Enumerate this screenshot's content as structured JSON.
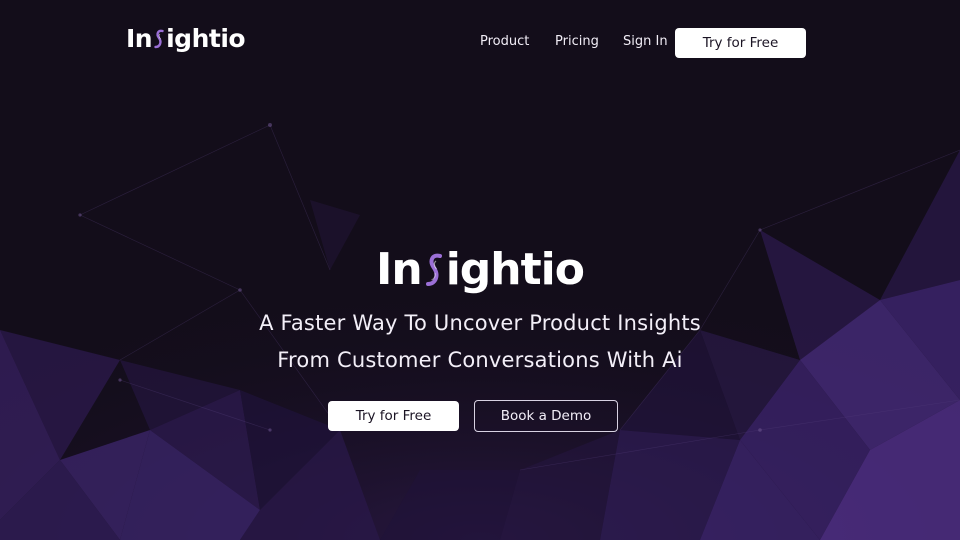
{
  "nav": {
    "brand_prefix": "In",
    "brand_suffix": "ightio",
    "links": [
      {
        "label": "Product"
      },
      {
        "label": "Pricing"
      },
      {
        "label": "Sign In"
      }
    ],
    "cta_label": "Try for Free"
  },
  "hero": {
    "brand_prefix": "In",
    "brand_suffix": "ightio",
    "tagline_line1": "A Faster Way To Uncover Product Insights",
    "tagline_line2": "From Customer Conversations With Ai",
    "primary_cta": "Try for Free",
    "secondary_cta": "Book a Demo"
  },
  "icons": {
    "brand_mark": "fingerprint-s-icon"
  },
  "colors": {
    "background": "#130d1a",
    "accent_purple": "#6a3fb5",
    "brand_mark_purple": "#9b6fd6",
    "button_bg": "#ffffff",
    "button_text": "#1b1424"
  }
}
